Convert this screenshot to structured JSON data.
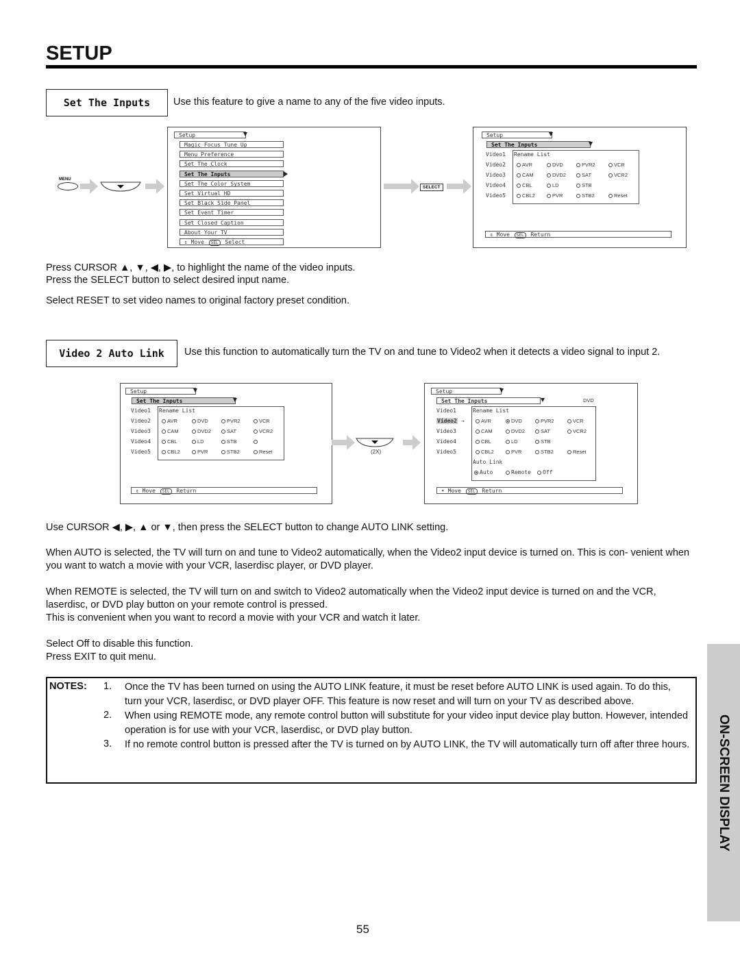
{
  "page": {
    "section_title": "SETUP",
    "page_number": "55",
    "side_tab": "ON-SCREEN DISPLAY"
  },
  "set_inputs": {
    "label": "Set The Inputs",
    "intro": "Use this feature to give a name to any of the five video inputs.",
    "remote_menu_label": "MENU",
    "select_button": "SELECT",
    "osd_left": {
      "header": "Setup",
      "items": [
        "Magic Focus Tune Up",
        "Menu Preference",
        "Set The Clock",
        "Set The Inputs",
        "Set The Color System",
        "Set Virtual HD",
        "Set Black Side Panel",
        "Set Event Timer",
        "Set Closed Caption",
        "About Your TV"
      ],
      "highlighted_index": 3,
      "footer_move": "Move",
      "footer_sel": "SEL",
      "footer_action": "Select"
    },
    "osd_right": {
      "header": "Setup",
      "sub_header": "Set The Inputs",
      "rename_title": "Rename List",
      "videos": [
        "Video1",
        "Video2",
        "Video3",
        "Video4",
        "Video5"
      ],
      "options": [
        [
          "AVR",
          "DVD",
          "PVR2",
          "VCR"
        ],
        [
          "CAM",
          "DVD2",
          "SAT",
          "VCR2"
        ],
        [
          "CBL",
          "LD",
          "STB",
          ""
        ],
        [
          "CBL2",
          "PVR",
          "STB2",
          "Reset"
        ]
      ],
      "footer_move": "Move",
      "footer_sel": "SEL",
      "footer_action": "Return"
    },
    "instructions": [
      "Press CURSOR ▲, ▼, ◀, ▶, to highlight the name of the video inputs.",
      "Press the SELECT button to select desired input name.",
      "Select RESET to set video names to original factory preset condition."
    ]
  },
  "auto_link": {
    "label": "Video 2 Auto Link",
    "intro": "Use this function to automatically turn the TV on and tune to Video2 when it detects a video signal to input 2.",
    "press_count": "(2X)",
    "osd_left": {
      "header": "Setup",
      "sub_header": "Set The Inputs",
      "rename_title": "Rename List",
      "videos": [
        "Video1",
        "Video2",
        "Video3",
        "Video4",
        "Video5"
      ],
      "options": [
        [
          "AVR",
          "DVD",
          "PVR2",
          "VCR"
        ],
        [
          "CAM",
          "DVD2",
          "SAT",
          "VCR2"
        ],
        [
          "CBL",
          "LD",
          "STB",
          ""
        ],
        [
          "CBL2",
          "PVR",
          "STB2",
          "Reset"
        ]
      ],
      "footer_move": "Move",
      "footer_sel": "SEL",
      "footer_action": "Return"
    },
    "osd_right": {
      "header": "Setup",
      "sub_header": "Set The Inputs",
      "current_name": "DVD",
      "rename_title": "Rename List",
      "videos": [
        "Video1",
        "Video2",
        "Video3",
        "Video4",
        "Video5"
      ],
      "highlighted_video": "Video2",
      "options": [
        [
          "AVR",
          "DVD",
          "PVR2",
          "VCR"
        ],
        [
          "CAM",
          "DVD2",
          "SAT",
          "VCR2"
        ],
        [
          "CBL",
          "LD",
          "STB",
          ""
        ],
        [
          "CBL2",
          "PVR",
          "STB2",
          "Reset"
        ]
      ],
      "selected_option": "DVD",
      "auto_link_title": "Auto Link",
      "auto_link_options": [
        "Auto",
        "Remote",
        "Off"
      ],
      "auto_link_selected": "Auto",
      "footer_move": "Move",
      "footer_sel": "SEL",
      "footer_action": "Return"
    },
    "paragraphs": [
      "Use CURSOR ◀, ▶, ▲ or ▼, then press the SELECT button to change AUTO LINK setting.",
      "When AUTO is selected, the TV will turn on and tune to Video2 automatically, when the Video2 input device is turned on. This is con- venient when you want to watch a movie with your VCR, laserdisc player, or DVD player.",
      "When REMOTE is selected, the TV will turn on and switch to Video2 automatically when the Video2 input device is turned on and the VCR, laserdisc, or DVD play button on your remote control is pressed.",
      "This is convenient when you want to record a movie with your VCR and watch it later.",
      "Select Off to disable this function.",
      "Press EXIT to quit menu."
    ]
  },
  "notes": {
    "label": "NOTES:",
    "items": [
      {
        "num": "1.",
        "text": "Once the TV has been turned on using the AUTO LINK feature, it must be reset before AUTO LINK is used again. To do this, turn your VCR, laserdisc, or DVD player OFF. This feature is now reset and will turn on your TV as described above."
      },
      {
        "num": "2.",
        "text": "When using REMOTE mode, any remote control button will substitute for your video input device play button. However, intended operation is for use with your VCR, laserdisc, or DVD play button."
      },
      {
        "num": "3.",
        "text": "If no remote control button is pressed after the TV is turned on by AUTO LINK, the TV will automatically turn off after three hours."
      }
    ]
  }
}
